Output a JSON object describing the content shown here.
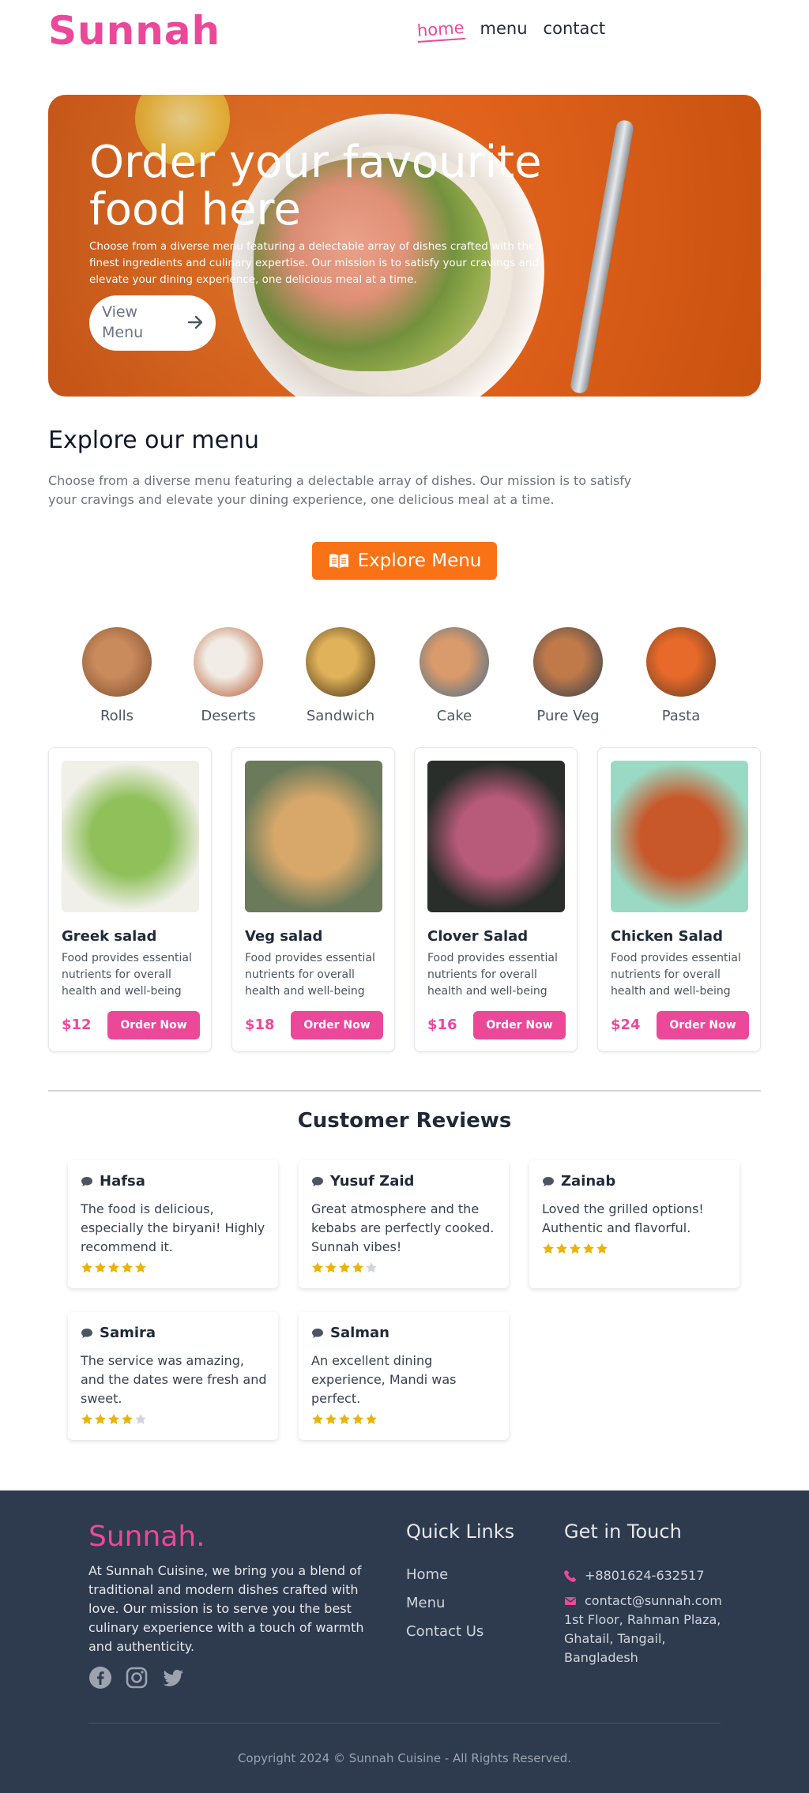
{
  "header": {
    "logo": "Sunnah",
    "nav": [
      {
        "label": "home",
        "active": true
      },
      {
        "label": "menu",
        "active": false
      },
      {
        "label": "contact",
        "active": false
      }
    ]
  },
  "hero": {
    "title": "Order your favourite food here",
    "text": "Choose from a diverse menu featuring a delectable array of dishes crafted with the finest ingredients and culinary expertise. Our mission is to satisfy your cravings and elevate your dining experience, one delicious meal at a time.",
    "button_label": "View Menu"
  },
  "explore": {
    "heading": "Explore our menu",
    "text": "Choose from a diverse menu featuring a delectable array of dishes. Our mission is to satisfy your cravings and elevate your dining experience, one delicious meal at a time.",
    "button_label": "Explore Menu"
  },
  "categories": [
    {
      "label": "Rolls",
      "colors": [
        "#c98a5c",
        "#7a4a2a"
      ]
    },
    {
      "label": "Deserts",
      "colors": [
        "#f1ede6",
        "#b24a1e"
      ]
    },
    {
      "label": "Sandwich",
      "colors": [
        "#e0b35a",
        "#3a2410"
      ]
    },
    {
      "label": "Cake",
      "colors": [
        "#d99a6c",
        "#3a6a8a"
      ]
    },
    {
      "label": "Pure Veg",
      "colors": [
        "#c07a4a",
        "#2a3a4a"
      ]
    },
    {
      "label": "Pasta",
      "colors": [
        "#e86a2a",
        "#5a3a22"
      ]
    }
  ],
  "products": [
    {
      "name": "Greek salad",
      "desc": "Food provides essential nutrients for overall health and well-being",
      "price": "$12",
      "order_label": "Order Now",
      "colors": [
        "#8fc05a",
        "#f0efe8"
      ]
    },
    {
      "name": "Veg salad",
      "desc": "Food provides essential nutrients for overall health and well-being",
      "price": "$18",
      "order_label": "Order Now",
      "colors": [
        "#d8a86a",
        "#6a7a5a"
      ]
    },
    {
      "name": "Clover Salad",
      "desc": "Food provides essential nutrients for overall health and well-being",
      "price": "$16",
      "order_label": "Order Now",
      "colors": [
        "#b85a7a",
        "#2a2e2a"
      ]
    },
    {
      "name": "Chicken Salad",
      "desc": "Food provides essential nutrients for overall health and well-being",
      "price": "$24",
      "order_label": "Order Now",
      "colors": [
        "#c8582a",
        "#9adac4"
      ]
    }
  ],
  "reviews": {
    "heading": "Customer Reviews",
    "items": [
      {
        "name": "Hafsa",
        "text": "The food is delicious, especially the biryani! Highly recommend it.",
        "rating": 5
      },
      {
        "name": "Yusuf Zaid",
        "text": "Great atmosphere and the kebabs are perfectly cooked. Sunnah vibes!",
        "rating": 4
      },
      {
        "name": "Zainab",
        "text": "Loved the grilled options! Authentic and flavorful.",
        "rating": 5
      },
      {
        "name": "Samira",
        "text": "The service was amazing, and the dates were fresh and sweet.",
        "rating": 4
      },
      {
        "name": "Salman",
        "text": "An excellent dining experience, Mandi was perfect.",
        "rating": 5
      }
    ]
  },
  "footer": {
    "logo": "Sunnah.",
    "about": "At Sunnah Cuisine, we bring you a blend of traditional and modern dishes crafted with love. Our mission is to serve you the best culinary experience with a touch of warmth and authenticity.",
    "social": [
      "facebook-icon",
      "instagram-icon",
      "twitter-icon"
    ],
    "quick_links_heading": "Quick Links",
    "quick_links": [
      "Home",
      "Menu",
      "Contact Us"
    ],
    "contact_heading": "Get in Touch",
    "phone": "+8801624-632517",
    "email": "contact@sunnah.com",
    "address": "1st Floor, Rahman Plaza, Ghatail, Tangail, Bangladesh",
    "copyright": "Copyright 2024 © Sunnah Cuisine - All Rights Reserved."
  },
  "colors": {
    "brand_pink": "#ec4899",
    "accent_orange": "#f97316",
    "star_yellow": "#eab308",
    "footer_bg": "#2e3a4e"
  }
}
